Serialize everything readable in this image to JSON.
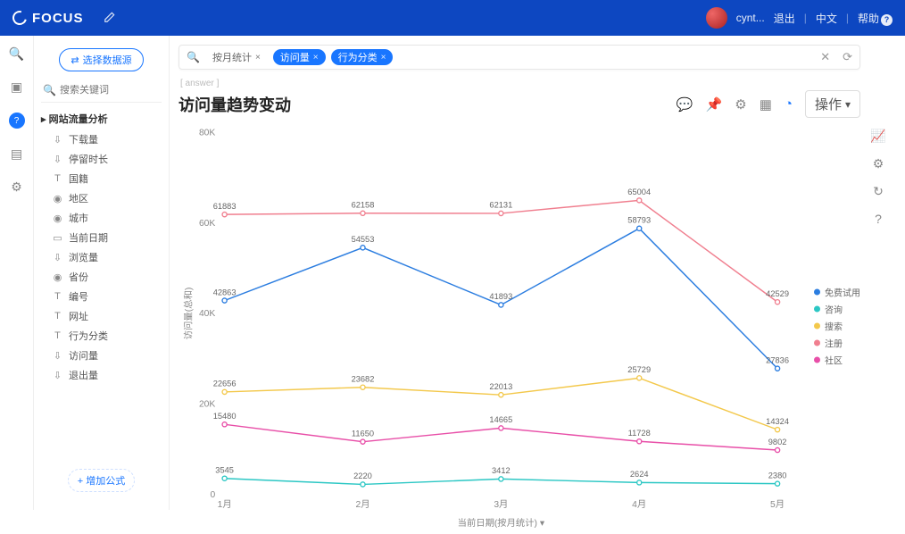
{
  "topbar": {
    "brand": "FOCUS",
    "user": "cynt...",
    "links": {
      "logout": "退出",
      "lang": "中文",
      "help": "帮助"
    },
    "help_badge": "?"
  },
  "side": {
    "select_ds": "选择数据源",
    "search_ph": "搜索关键词",
    "category": "网站流量分析",
    "fields": [
      {
        "icon": "⇩",
        "label": "下载量"
      },
      {
        "icon": "⇩",
        "label": "停留时长"
      },
      {
        "icon": "T",
        "label": "国籍"
      },
      {
        "icon": "◉",
        "label": "地区"
      },
      {
        "icon": "◉",
        "label": "城市"
      },
      {
        "icon": "▭",
        "label": "当前日期"
      },
      {
        "icon": "⇩",
        "label": "浏览量"
      },
      {
        "icon": "◉",
        "label": "省份"
      },
      {
        "icon": "T",
        "label": "编号"
      },
      {
        "icon": "T",
        "label": "网址"
      },
      {
        "icon": "T",
        "label": "行为分类"
      },
      {
        "icon": "⇩",
        "label": "访问量"
      },
      {
        "icon": "⇩",
        "label": "退出量"
      }
    ],
    "add_formula": "+ 增加公式"
  },
  "query": {
    "tokens": [
      {
        "kind": "txt",
        "label": "按月统计",
        "x": "×"
      },
      {
        "kind": "pill",
        "label": "访问量",
        "x": "×"
      },
      {
        "kind": "pill",
        "label": "行为分类",
        "x": "×"
      }
    ],
    "subtitle": "[ answer ]",
    "title": "访问量趋势变动",
    "op": "操作"
  },
  "chart_data": {
    "type": "line",
    "xlabel": "当前日期(按月统计)",
    "ylabel": "访问量(总和)",
    "categories": [
      "1月",
      "2月",
      "3月",
      "4月",
      "5月"
    ],
    "ylim": [
      0,
      80000
    ],
    "yticks": [
      0,
      20000,
      40000,
      60000,
      80000
    ],
    "ytick_labels": [
      "0",
      "20K",
      "40K",
      "60K",
      "80K"
    ],
    "series": [
      {
        "name": "免费试用",
        "color": "#2b7de0",
        "values": [
          42863,
          54553,
          41893,
          58793,
          27836
        ]
      },
      {
        "name": "咨询",
        "color": "#2bc7c4",
        "values": [
          3545,
          2220,
          3412,
          2624,
          2380
        ]
      },
      {
        "name": "搜索",
        "color": "#f3c84b",
        "values": [
          22656,
          23682,
          22013,
          25729,
          14324
        ]
      },
      {
        "name": "注册",
        "color": "#f07f8f",
        "values": [
          61883,
          62158,
          62131,
          65004,
          42529
        ]
      },
      {
        "name": "社区",
        "color": "#e84fa8",
        "values": [
          15480,
          11650,
          14665,
          11728,
          9802
        ]
      }
    ]
  }
}
